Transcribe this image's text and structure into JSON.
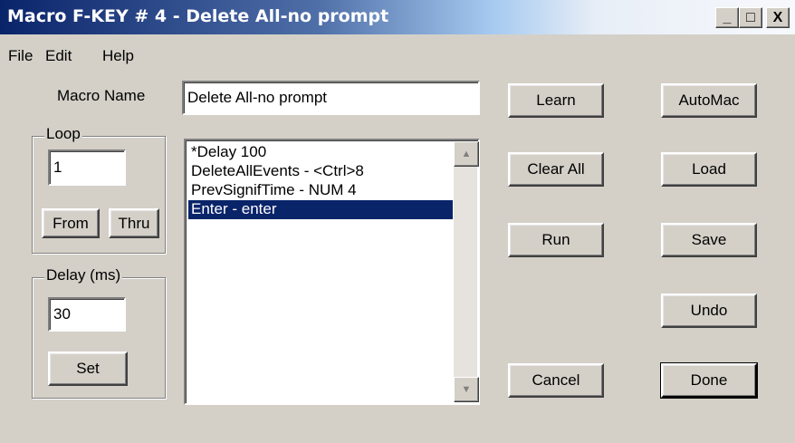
{
  "window": {
    "title": "Macro F-KEY # 4 - Delete All-no prompt",
    "minimize": "_",
    "maximize": "□",
    "close": "X"
  },
  "menu": [
    "File",
    "Edit",
    "Help"
  ],
  "macro_name": {
    "label": "Macro Name",
    "value": "Delete All-no prompt"
  },
  "loop": {
    "label": "Loop",
    "value": "1",
    "from": "From",
    "thru": "Thru"
  },
  "delay": {
    "label": "Delay (ms)",
    "value": "30",
    "set": "Set"
  },
  "list": {
    "items": [
      "*Delay 100",
      "DeleteAllEvents - <Ctrl>8",
      "PrevSignifTime - NUM 4",
      "Enter - enter"
    ],
    "selected_index": 3,
    "scroll_up": "▲",
    "scroll_down": "▼"
  },
  "buttons": {
    "learn": "Learn",
    "clear_all": "Clear All",
    "run": "Run",
    "cancel": "Cancel",
    "automac": "AutoMac",
    "load": "Load",
    "save": "Save",
    "undo": "Undo",
    "done": "Done"
  },
  "colors": {
    "title_start": "#0a246a",
    "face": "#d4d0c8",
    "selection": "#0a246a"
  }
}
